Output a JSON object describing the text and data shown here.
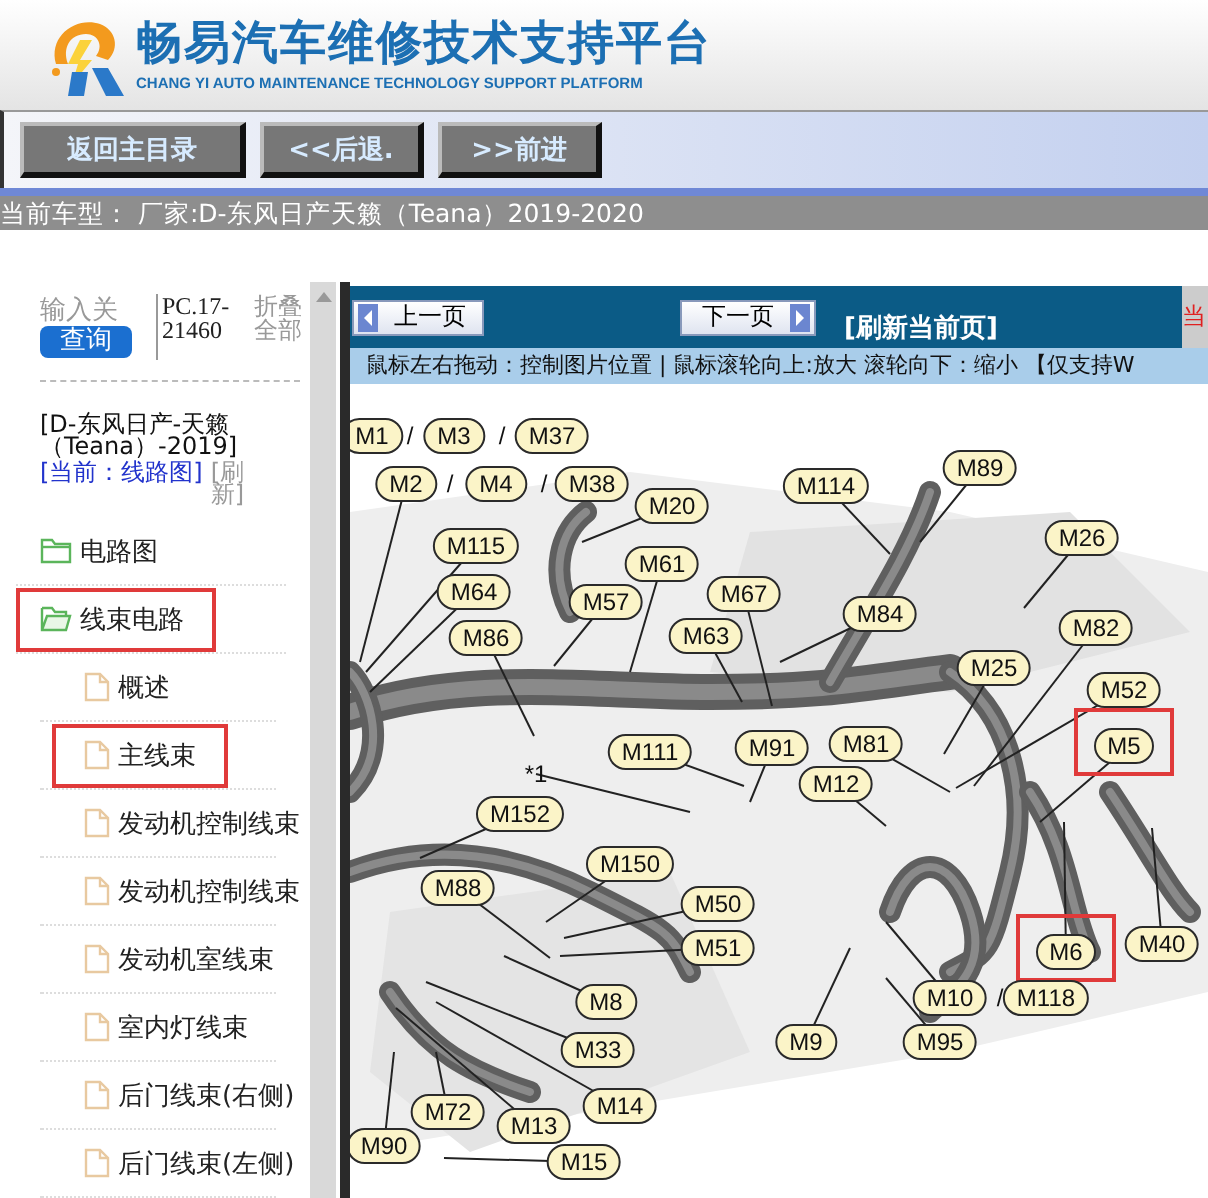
{
  "header": {
    "title": "畅易汽车维修技术支持平台",
    "subtitle": "CHANG YI AUTO MAINTENANCE TECHNOLOGY SUPPORT PLATFORM"
  },
  "toolbar": {
    "buttons": [
      "返回主目录",
      "<<后退.",
      ">>前进"
    ]
  },
  "current_model": "当前车型：  厂家:D-东风日产天籁（Teana）2019-2020",
  "sidebar": {
    "search": {
      "placeholder": "输入关",
      "button": "查询"
    },
    "code": "PC.17-21460",
    "collapse_link": "折叠全部",
    "vehicle": "[D-东风日产-天籁（Teana）-2019]",
    "current": "[当前：线路图]",
    "refresh": "[刷新]",
    "tree": [
      {
        "label": "电路图",
        "kind": "folder",
        "expanded": false,
        "highlighted": false
      },
      {
        "label": "线束电路",
        "kind": "folder",
        "expanded": true,
        "highlighted": true,
        "children": [
          {
            "label": "概述",
            "kind": "page",
            "highlighted": false
          },
          {
            "label": "主线束",
            "kind": "page",
            "highlighted": true
          },
          {
            "label": "发动机控制线束",
            "kind": "page",
            "highlighted": false
          },
          {
            "label": "发动机控制线束",
            "kind": "page",
            "highlighted": false
          },
          {
            "label": "发动机室线束",
            "kind": "page",
            "highlighted": false
          },
          {
            "label": "室内灯线束",
            "kind": "page",
            "highlighted": false
          },
          {
            "label": "后门线束(右侧)",
            "kind": "page",
            "highlighted": false
          },
          {
            "label": "后门线束(左侧)",
            "kind": "page",
            "highlighted": false
          }
        ]
      }
    ]
  },
  "viewer": {
    "prev_button": "上一页",
    "next_button": "下一页",
    "refresh_link": "[刷新当前页]",
    "edge_text": "当",
    "instructions": "鼠标左右拖动：控制图片位置 | 鼠标滚轮向上:放大  滚轮向下：缩小 【仅支持W",
    "labels": [
      {
        "text": "M1",
        "kind": "tag",
        "highlighted": false
      },
      {
        "text": "/",
        "kind": "slash"
      },
      {
        "text": "M3",
        "kind": "tag",
        "highlighted": false
      },
      {
        "text": "/",
        "kind": "slash"
      },
      {
        "text": "M37",
        "kind": "tag",
        "highlighted": false
      },
      {
        "text": "M89",
        "kind": "tag",
        "highlighted": false
      },
      {
        "text": "M2",
        "kind": "tag",
        "highlighted": false
      },
      {
        "text": "/",
        "kind": "slash"
      },
      {
        "text": "M4",
        "kind": "tag",
        "highlighted": false
      },
      {
        "text": "/",
        "kind": "slash"
      },
      {
        "text": "M38",
        "kind": "tag",
        "highlighted": false
      },
      {
        "text": "M114",
        "kind": "tag",
        "highlighted": false
      },
      {
        "text": "M20",
        "kind": "tag",
        "highlighted": false
      },
      {
        "text": "M26",
        "kind": "tag",
        "highlighted": false
      },
      {
        "text": "M115",
        "kind": "tag",
        "highlighted": false
      },
      {
        "text": "M61",
        "kind": "tag",
        "highlighted": false
      },
      {
        "text": "M64",
        "kind": "tag",
        "highlighted": false
      },
      {
        "text": "M57",
        "kind": "tag",
        "highlighted": false
      },
      {
        "text": "M67",
        "kind": "tag",
        "highlighted": false
      },
      {
        "text": "M84",
        "kind": "tag",
        "highlighted": false
      },
      {
        "text": "M82",
        "kind": "tag",
        "highlighted": false
      },
      {
        "text": "M86",
        "kind": "tag",
        "highlighted": false
      },
      {
        "text": "M63",
        "kind": "tag",
        "highlighted": false
      },
      {
        "text": "M25",
        "kind": "tag",
        "highlighted": false
      },
      {
        "text": "M52",
        "kind": "tag",
        "highlighted": false
      },
      {
        "text": "M111",
        "kind": "tag",
        "highlighted": false
      },
      {
        "text": "M91",
        "kind": "tag",
        "highlighted": false
      },
      {
        "text": "M81",
        "kind": "tag",
        "highlighted": false
      },
      {
        "text": "M5",
        "kind": "tag",
        "highlighted": true
      },
      {
        "text": "*1",
        "kind": "note"
      },
      {
        "text": "M12",
        "kind": "tag",
        "highlighted": false
      },
      {
        "text": "M152",
        "kind": "tag",
        "highlighted": false
      },
      {
        "text": "M150",
        "kind": "tag",
        "highlighted": false
      },
      {
        "text": "M88",
        "kind": "tag",
        "highlighted": false
      },
      {
        "text": "M50",
        "kind": "tag",
        "highlighted": false
      },
      {
        "text": "M51",
        "kind": "tag",
        "highlighted": false
      },
      {
        "text": "M6",
        "kind": "tag",
        "highlighted": true
      },
      {
        "text": "M40",
        "kind": "tag",
        "highlighted": false
      },
      {
        "text": "M8",
        "kind": "tag",
        "highlighted": false
      },
      {
        "text": "M10",
        "kind": "tag",
        "highlighted": false
      },
      {
        "text": "/",
        "kind": "slash"
      },
      {
        "text": "M118",
        "kind": "tag",
        "highlighted": false
      },
      {
        "text": "M33",
        "kind": "tag",
        "highlighted": false
      },
      {
        "text": "M9",
        "kind": "tag",
        "highlighted": false
      },
      {
        "text": "M95",
        "kind": "tag",
        "highlighted": false
      },
      {
        "text": "M14",
        "kind": "tag",
        "highlighted": false
      },
      {
        "text": "M72",
        "kind": "tag",
        "highlighted": false
      },
      {
        "text": "M13",
        "kind": "tag",
        "highlighted": false
      },
      {
        "text": "M90",
        "kind": "tag",
        "highlighted": false
      },
      {
        "text": "M15",
        "kind": "tag",
        "highlighted": false
      }
    ]
  }
}
